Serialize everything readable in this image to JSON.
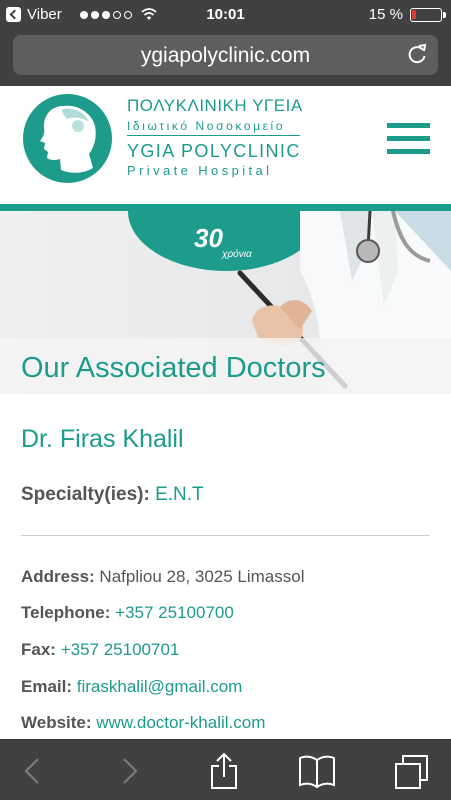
{
  "status_bar": {
    "carrier": "Viber",
    "time": "10:01",
    "battery_percent": "15 %",
    "battery_level": 0.15,
    "signal_bars_filled": 3,
    "signal_bars_total": 5,
    "icons": [
      "back-to-app-icon",
      "signal-dots-icon",
      "wifi-icon",
      "battery-icon"
    ]
  },
  "browser": {
    "url": "ygiapolyclinic.com",
    "reload_icon": "reload-icon",
    "toolbar_icons": [
      "back-arrow-icon",
      "forward-arrow-icon",
      "share-icon",
      "bookmarks-icon",
      "tabs-icon"
    ]
  },
  "site_header": {
    "logo_greek_title": "ΠΟΛΥΚΛΙΝΙΚΗ ΥΓΕΙΑ",
    "logo_greek_subtitle": "Ιδιωτικό Νοσοκομείο",
    "logo_english_title": "YGIA POLYCLINIC",
    "logo_english_subtitle": "Private Hospital",
    "menu_icon": "hamburger-menu-icon",
    "brand_color": "#1d9c8c"
  },
  "hero": {
    "badge_number": "30",
    "badge_text": "χρόνια",
    "title": "Our Associated Doctors"
  },
  "doctor": {
    "name": "Dr. Firas Khalil",
    "specialty_label": "Specialty(ies):",
    "specialty_value": "E.N.T",
    "details": [
      {
        "label": "Address:",
        "value": "Nafpliou 28, 3025 Limassol",
        "is_link": false
      },
      {
        "label": "Telephone:",
        "value": "+357 25100700",
        "is_link": true
      },
      {
        "label": "Fax:",
        "value": "+357 25100701",
        "is_link": true
      },
      {
        "label": "Email:",
        "value": "firaskhalil@gmail.com",
        "is_link": true
      },
      {
        "label": "Website:",
        "value": "www.doctor-khalil.com",
        "is_link": true
      }
    ]
  }
}
